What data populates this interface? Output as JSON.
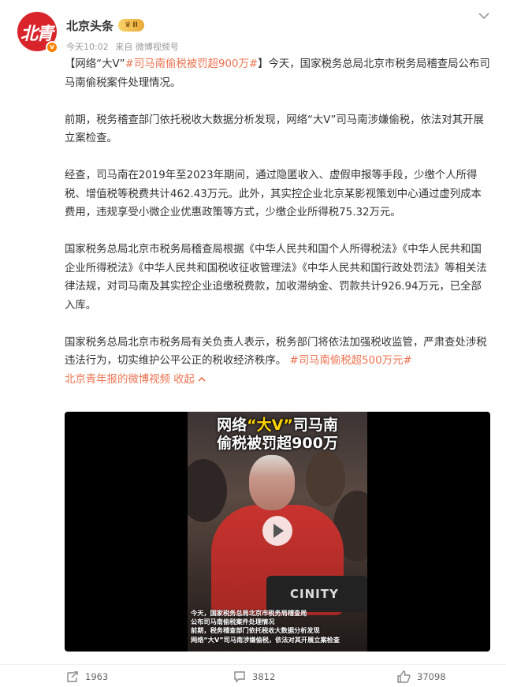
{
  "author": {
    "name": "北京头条",
    "level": "II",
    "avatar_text": "北青",
    "verify_mark": "v"
  },
  "meta": {
    "time": "今天10:02",
    "source": "来自 微博视频号"
  },
  "post": {
    "p1_open": "【",
    "p1_tag": "网络“大V”",
    "p1_tag2": "#司马南偷税被罚超900万#",
    "p1_rest": "】今天，国家税务总局北京市税务局稽查局公布司马南偷税案件处理情况。",
    "p2": "前期，税务稽查部门依托税收大数据分析发现，网络“大V”司马南涉嫌偷税，依法对其开展立案检查。",
    "p3": "经查，司马南在2019年至2023年期间，通过隐匿收入、虚假申报等手段，少缴个人所得税、增值税等税费共计462.43万元。此外，其实控企业北京某影视策划中心通过虚列成本费用，违规享受小微企业优惠政策等方式，少缴企业所得税75.32万元。",
    "p4": "国家税务总局北京市税务局稽查局根据《中华人民共和国个人所得税法》《中华人民共和国企业所得税法》《中华人民共和国税收征收管理法》《中华人民共和国行政处罚法》等相关法律法规，对司马南及其实控企业追缴税费款，加收滞纳金、罚款共计926.94万元，已全部入库。",
    "p5": "国家税务总局北京市税务局有关负责人表示，税务部门将依法加强税收监管，严肃查处涉税违法行为，切实维护公平公正的税收经济秩序。",
    "p5_tag": "#司马南偷税超500万元#",
    "video_link": "北京青年报的微博视频",
    "collapse": "收起"
  },
  "video": {
    "headline_line1_a": "网络",
    "headline_line1_q": "“大V”",
    "headline_line1_b": "司马南",
    "headline_line2": "偷税被罚超900万",
    "seat_logo": "CINITY",
    "caption_lines": [
      "今天，国家税务总局北京市税务局稽查局",
      "公布司马南偷税案件处理情况",
      "前期，税务稽查部门依托税收大数据分析发现",
      "网络“大V”司马南涉嫌偷税，依法对其开展立案检查"
    ]
  },
  "actions": {
    "repost_count": "1963",
    "comment_count": "3812",
    "like_count": "37098"
  },
  "colors": {
    "tag": "#eb7350",
    "brand_red": "#d9242b",
    "text": "#333333",
    "meta": "#999999"
  }
}
